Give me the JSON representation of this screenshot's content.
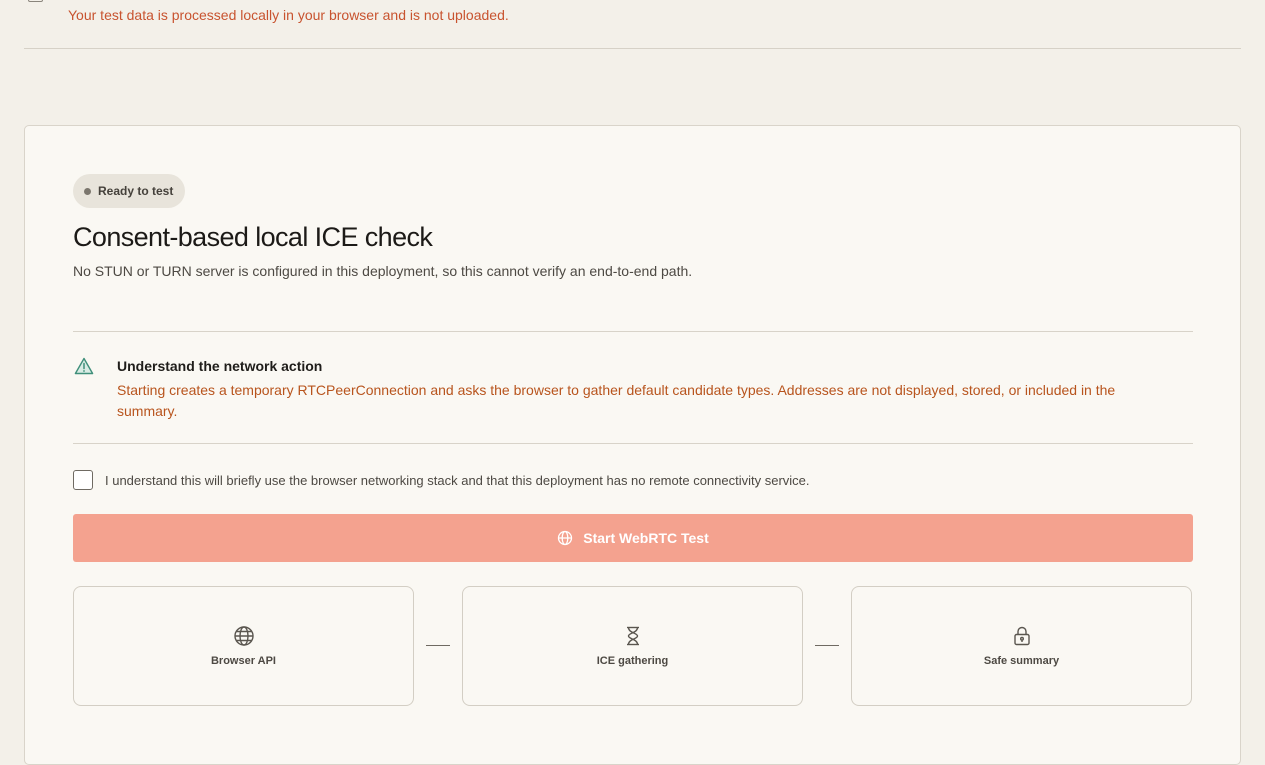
{
  "privacy_note": "Your test data is processed locally in your browser and is not uploaded.",
  "card": {
    "status": "Ready to test",
    "title": "Consent-based local ICE check",
    "subtitle": "No STUN or TURN server is configured in this deployment, so this cannot verify an end-to-end path.",
    "warning": {
      "icon": "warning-triangle-icon",
      "heading": "Understand the network action",
      "body": "Starting creates a temporary RTCPeerConnection and asks the browser to gather default candidate types. Addresses are not displayed, stored, or included in the summary."
    },
    "consent": {
      "checked": false,
      "label": "I understand this will briefly use the browser networking stack and that this deployment has no remote connectivity service."
    },
    "start_button": {
      "label": "Start WebRTC Test",
      "icon": "globe-icon"
    },
    "steps": [
      {
        "label": "Browser API",
        "icon": "globe-icon"
      },
      {
        "label": "ICE gathering",
        "icon": "hourglass-icon"
      },
      {
        "label": "Safe summary",
        "icon": "lock-icon"
      }
    ]
  },
  "colors": {
    "background": "#f3f0e9",
    "card": "#faf8f3",
    "accent_disabled": "#f4a28f",
    "warning_text": "#b8541d",
    "privacy_text": "#c8532f",
    "warning_icon": "#3f8f7a"
  }
}
